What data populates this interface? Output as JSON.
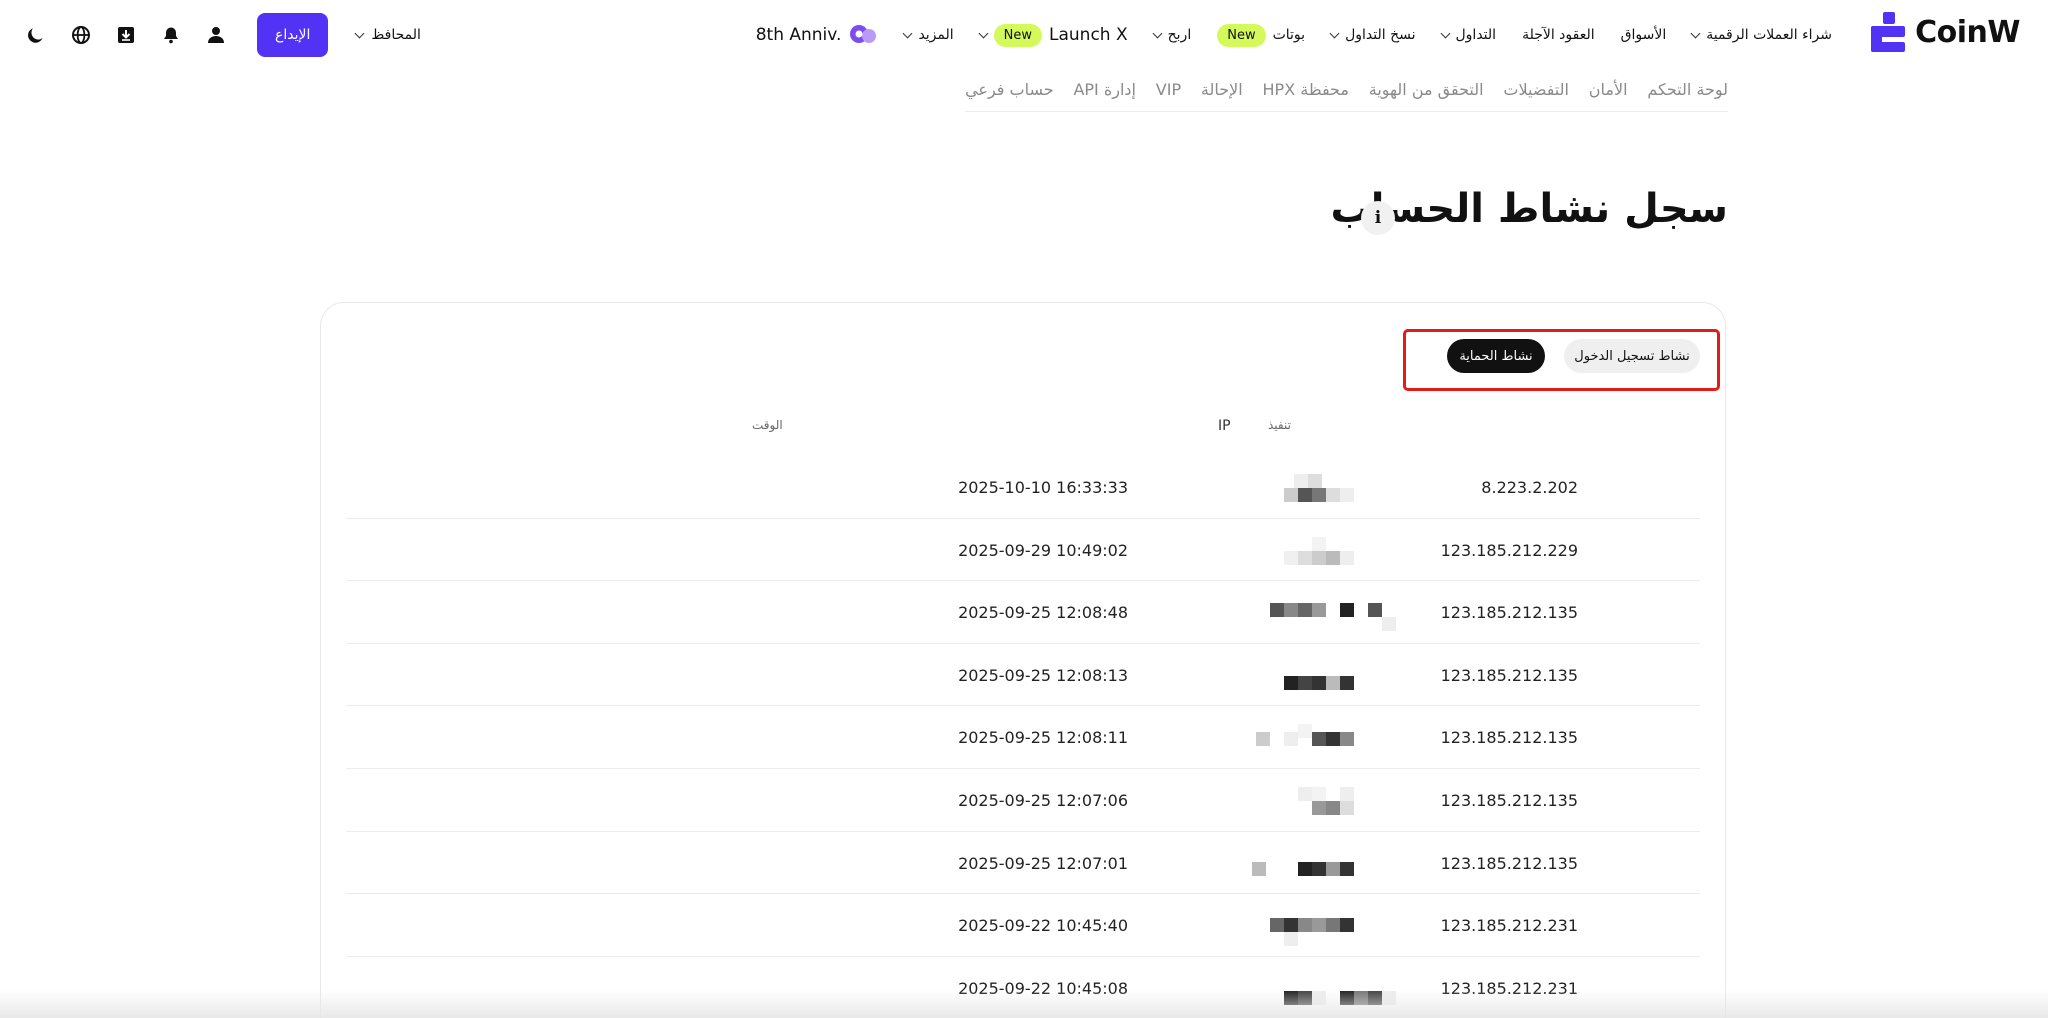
{
  "brand": {
    "name": "CoinW",
    "accent": "#5233f5"
  },
  "nav": {
    "items": [
      {
        "label": "شراء العملات الرقمية",
        "chevron": true
      },
      {
        "label": "الأسواق",
        "chevron": false
      },
      {
        "label": "العقود الآجلة",
        "chevron": false
      },
      {
        "label": "التداول",
        "chevron": true
      },
      {
        "label": "نسخ التداول",
        "chevron": true
      },
      {
        "label": "بوتات",
        "badge": "New",
        "chevron": false
      },
      {
        "label": "اربح",
        "chevron": true
      },
      {
        "label": "Launch X",
        "badge": "New",
        "chevron": true
      },
      {
        "label": "المزيد",
        "chevron": true
      },
      {
        "label": "8th Anniv.",
        "chevron": false
      }
    ],
    "wallet_label": "المحافظ",
    "deposit_label": "الإيداع",
    "icons": [
      "user-icon",
      "bell-icon",
      "download-icon",
      "globe-icon",
      "moon-icon"
    ]
  },
  "subtabs": [
    "لوحة التحكم",
    "الأمان",
    "التفضيلات",
    "التحقق من الهوية",
    "محفظة HPX",
    "الإحالة",
    "VIP",
    "إدارة API",
    "حساب فرعي"
  ],
  "page_title": "سجل نشاط الحساب",
  "info_symbol": "i",
  "tabs": {
    "login_activity": "نشاط تسجيل الدخول",
    "protection_activity": "نشاط الحماية",
    "active": "protection_activity"
  },
  "table": {
    "headers": {
      "execution": "تنفيذ",
      "ip": "IP",
      "time": "الوقت"
    },
    "rows": [
      {
        "ip": "8.223.2.202",
        "time": "2025-10-10 16:33:33"
      },
      {
        "ip": "123.185.212.229",
        "time": "2025-09-29 10:49:02"
      },
      {
        "ip": "123.185.212.135",
        "time": "2025-09-25 12:08:48"
      },
      {
        "ip": "123.185.212.135",
        "time": "2025-09-25 12:08:13"
      },
      {
        "ip": "123.185.212.135",
        "time": "2025-09-25 12:08:11"
      },
      {
        "ip": "123.185.212.135",
        "time": "2025-09-25 12:07:06"
      },
      {
        "ip": "123.185.212.135",
        "time": "2025-09-25 12:07:01"
      },
      {
        "ip": "123.185.212.231",
        "time": "2025-09-22 10:45:40"
      },
      {
        "ip": "123.185.212.231",
        "time": "2025-09-22 10:45:08"
      }
    ]
  }
}
